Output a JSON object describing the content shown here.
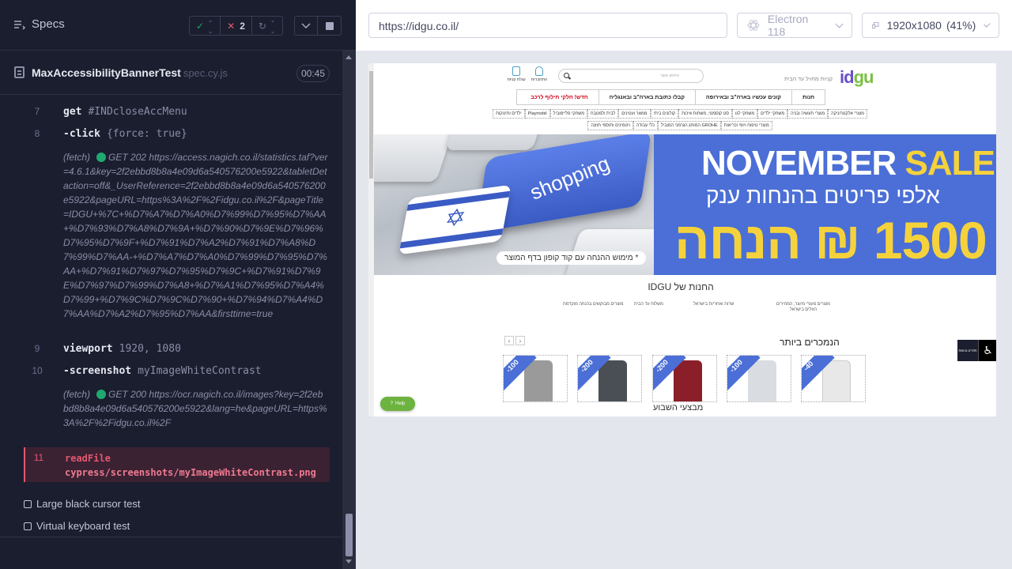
{
  "reporter": {
    "title": "Specs",
    "stats": {
      "passed": "--",
      "failed": "2",
      "pending": "--"
    },
    "spec": {
      "name": "MaxAccessibilityBannerTest",
      "file": "spec.cy.js",
      "duration": "00:45"
    },
    "commands": [
      {
        "n": "7",
        "name": "get",
        "arg": "#INDcloseAccMenu"
      },
      {
        "n": "8",
        "name": "-click",
        "arg": "{force: true}"
      },
      {
        "n": "9",
        "name": "viewport",
        "arg": "1920, 1080"
      },
      {
        "n": "10",
        "name": "-screenshot",
        "arg": "myImageWhiteContrast"
      }
    ],
    "log1": {
      "prefix": "(fetch)",
      "method": "GET 202",
      "url": "https://access.nagich.co.il/statistics.taf?ver=4.6.1&key=2f2ebbd8b8a4e09d6a540576200e5922&tabletDetaction=off&_UserReference=2f2ebbd8b8a4e09d6a540576200e5922&pageURL=https%3A%2F%2Fidgu.co.il%2F&pageTitle=IDGU+%7C+%D7%A7%D7%A0%D7%99%D7%95%D7%AA+%D7%93%D7%A8%D7%9A+%D7%90%D7%9E%D7%96%D7%95%D7%9F+%D7%91%D7%A2%D7%91%D7%A8%D7%99%D7%AA-+%D7%A7%D7%A0%D7%99%D7%95%D7%AA+%D7%91%D7%97%D7%95%D7%9C+%D7%91%D7%9E%D7%97%D7%99%D7%A8+%D7%A1%D7%95%D7%A4%D7%99+%D7%9C%D7%9C%D7%90+%D7%94%D7%A4%D7%AA%D7%A2%D7%95%D7%AA&firsttime=true"
    },
    "log2": {
      "prefix": "(fetch)",
      "method": "GET 200",
      "url": "https://ocr.nagich.co.il/images?key=2f2ebbd8b8a4e09d6a540576200e5922&lang=he&pageURL=https%3A%2F%2Fidgu.co.il%2F"
    },
    "failed_cmd": {
      "n": "11",
      "name": "readFile",
      "arg": "cypress/screenshots/myImageWhiteContrast.png"
    },
    "tests": [
      "Large black cursor test",
      "Virtual keyboard test"
    ]
  },
  "toolbar": {
    "url": "https://idgu.co.il/",
    "browser": "Electron 118",
    "viewport": "1920x1080",
    "scale": "(41%)"
  },
  "site": {
    "logo_a": "id",
    "logo_b": "gu",
    "tagline": "קניות מחויל עד הבית",
    "search_placeholder": "חיפוש מוצר",
    "icon_cart": "עגלת קניות",
    "icon_account": "התחברות",
    "main_nav": [
      "חנות",
      "קונים עכשיו בארה\"ב ובאירופה",
      "קבלו כתובת בארה\"ב ובאנגליה",
      "חדש! חלקי חילוף לרכב"
    ],
    "sub_nav": [
      "מוצרי אלקטרוניקה",
      "מוצרי תעשיה ובניה",
      "משחקי ילדים",
      "משחקי לגו",
      "סט קוסמטי, משחות איכות",
      "קולונים ביתי",
      "ממאר ועטינים",
      "לבית ולמטבח",
      "משחקי פליימוביל",
      "Playmobil",
      "ילדים ותינוקות",
      "מוצרי טיפוח ויופי וכריאות",
      "GROHE המותג הגרמני המוביל",
      "כלי עבודה",
      "ויטמינים ותוספי תזונה"
    ],
    "banner": {
      "key_text": "shopping",
      "note": "* מימוש ההנחה עם קוד קופון בדף המוצר",
      "title_a": "NOVEMBER",
      "title_b": "SALE",
      "sub": "אלפי פריטים בהנחות ענק",
      "big": "עד 1500 ₪ הנחה"
    },
    "store_title": "החנות של IDGU",
    "features": [
      "מוצרים מבוקשים בהנחה מוקדמת",
      "משלוח עד הבית",
      "שרות ואחריות בישראל",
      "מוצרים מעורי מיוצר, המחירים הזולים בישראל"
    ],
    "best_title": "הנמכרים ביותר",
    "products": [
      {
        "discount": "-100",
        "color": "#9a9a9a"
      },
      {
        "discount": "-200",
        "color": "#4a4f56"
      },
      {
        "discount": "-200",
        "color": "#8a1f2a"
      },
      {
        "discount": "-100",
        "color": "#d9dde2"
      },
      {
        "discount": "-40",
        "color": "#e8e8e8"
      }
    ],
    "weekly": "מבצעי השבוע",
    "help": "Help",
    "acc_label": "תפריט נגישות"
  }
}
